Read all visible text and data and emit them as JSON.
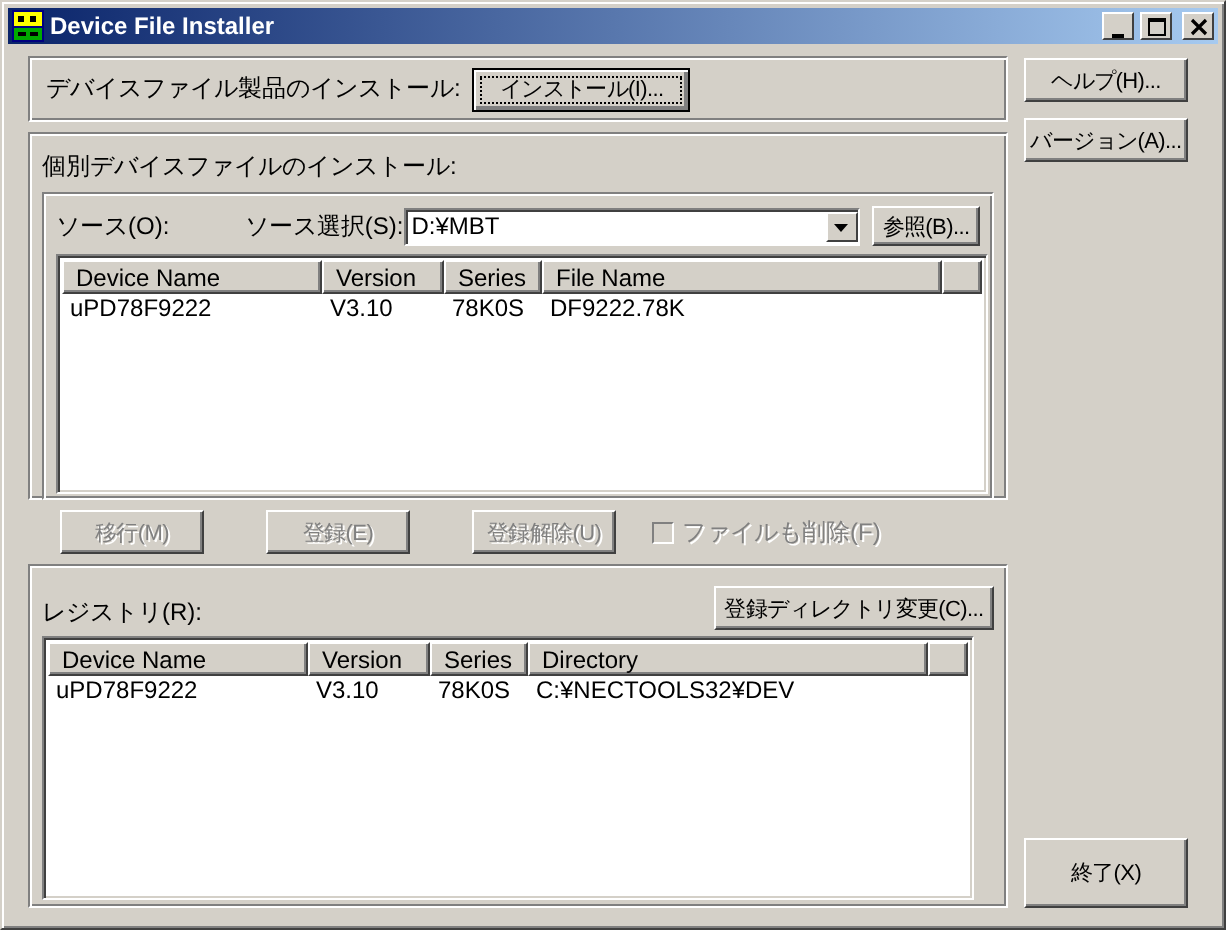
{
  "window": {
    "title": "Device File Installer"
  },
  "product_install": {
    "label": "デバイスファイル製品のインストール:",
    "button": {
      "label": "インストール(I)...",
      "default": true
    }
  },
  "individual": {
    "title": "個別デバイスファイルのインストール:",
    "source_label": "ソース(O):",
    "source_select_label": "ソース選択(S):",
    "source_value": "D:¥MBT",
    "browse_button": "参照(B)...",
    "list": {
      "columns": [
        "Device Name",
        "Version",
        "Series",
        "File Name"
      ],
      "rows": [
        [
          "uPD78F9222",
          "V3.10",
          "78K0S",
          "DF9222.78K"
        ]
      ]
    }
  },
  "actions": [
    {
      "label": "移行(M)",
      "disabled": true
    },
    {
      "label": "登録(E)",
      "disabled": true
    },
    {
      "label": "登録解除(U)",
      "disabled": true
    }
  ],
  "delete_files": {
    "label": "ファイルも削除(F)",
    "checked": false,
    "disabled": true
  },
  "registry": {
    "label": "レジストリ(R):",
    "button": "登録ディレクトリ変更(C)...",
    "list": {
      "columns": [
        "Device Name",
        "Version",
        "Series",
        "Directory"
      ],
      "rows": [
        [
          "uPD78F9222",
          "V3.10",
          "78K0S",
          "C:¥NECTOOLS32¥DEV"
        ]
      ]
    }
  },
  "side_buttons": [
    "ヘルプ(H)...",
    "バージョン(A)..."
  ],
  "exit_button": "終了(X)"
}
